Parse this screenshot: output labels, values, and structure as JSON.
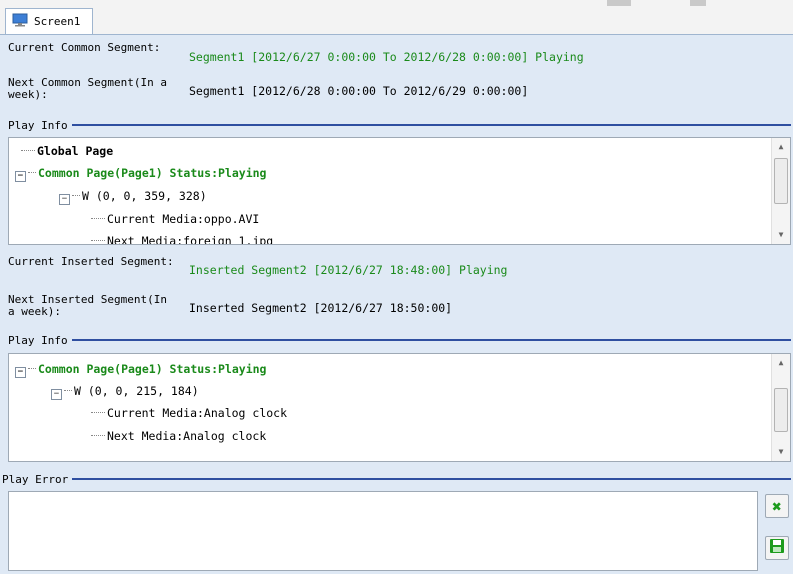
{
  "tab": {
    "label": "Screen1",
    "icon": "monitor-icon"
  },
  "common": {
    "current_label": "Current Common Segment:",
    "current_value": "Segment1 [2012/6/27 0:00:00 To 2012/6/28 0:00:00] Playing",
    "next_label": "Next Common Segment(In a week):",
    "next_value": "Segment1 [2012/6/28 0:00:00 To 2012/6/29 0:00:00]"
  },
  "play_info_1": {
    "title": "Play Info",
    "items": [
      "Global Page",
      "Common Page(Page1) Status:Playing",
      "W (0, 0, 359, 328)",
      "Current Media:oppo.AVI",
      "Next Media:foreign_1.jpg"
    ]
  },
  "inserted": {
    "current_label": "Current Inserted Segment:",
    "current_value": "Inserted Segment2 [2012/6/27 18:48:00] Playing",
    "next_label": "Next Inserted Segment(In a week):",
    "next_value": "Inserted Segment2 [2012/6/27 18:50:00]"
  },
  "play_info_2": {
    "title": "Play Info",
    "items": [
      "Common Page(Page1) Status:Playing",
      "W (0, 0, 215, 184)",
      "Current Media:Analog clock",
      "Next Media:Analog clock"
    ]
  },
  "play_error": {
    "title": "Play Error",
    "text": "",
    "buttons": {
      "clear": "clear-icon",
      "save": "save-icon"
    }
  },
  "colors": {
    "accent_line": "#2f4fa0",
    "status_green": "#1a8a1a"
  }
}
